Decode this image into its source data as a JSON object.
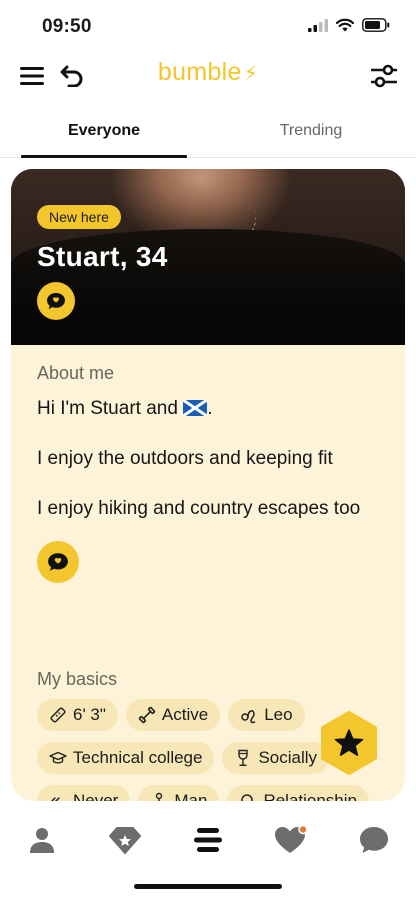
{
  "status_bar": {
    "time": "09:50"
  },
  "app": {
    "logo_text": "bumble"
  },
  "tabs": [
    {
      "label": "Everyone",
      "active": true
    },
    {
      "label": "Trending",
      "active": false
    }
  ],
  "profile": {
    "badge": "New here",
    "name_age": "Stuart, 34",
    "about_label": "About me",
    "bio_line1": "Hi I'm Stuart and",
    "bio_line1_end": ".",
    "bio_line2": "I enjoy the outdoors and keeping fit",
    "bio_line3": "I enjoy hiking and country escapes too",
    "basics_label": "My basics",
    "basics": [
      {
        "label": "6' 3\"",
        "icon": "ruler-icon"
      },
      {
        "label": "Active",
        "icon": "dumbbell-icon"
      },
      {
        "label": "Leo",
        "icon": "zodiac-icon"
      },
      {
        "label": "Technical college",
        "icon": "graduation-cap-icon"
      },
      {
        "label": "Socially",
        "icon": "wine-glass-icon"
      },
      {
        "label": "Never",
        "icon": "smoking-icon"
      },
      {
        "label": "Man",
        "icon": "person-icon"
      },
      {
        "label": "Relationship",
        "icon": "search-icon"
      }
    ]
  },
  "colors": {
    "accent": "#f4c62e",
    "card_bg": "#fdf3d8",
    "chip_bg": "#f7e7b6",
    "notification_dot": "#e07b39"
  },
  "bottom_nav": [
    {
      "name": "profile",
      "icon": "person-icon"
    },
    {
      "name": "discover",
      "icon": "diamond-icon"
    },
    {
      "name": "people",
      "icon": "stack-icon",
      "active": true
    },
    {
      "name": "liked-you",
      "icon": "heart-icon",
      "has_notification": true
    },
    {
      "name": "chats",
      "icon": "chat-icon"
    }
  ]
}
